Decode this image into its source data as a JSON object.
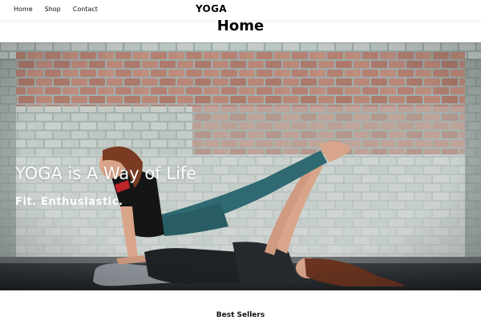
{
  "header": {
    "nav": [
      {
        "label": "Home"
      },
      {
        "label": "Shop"
      },
      {
        "label": "Contact"
      }
    ],
    "brand": "YOGA"
  },
  "page": {
    "title": "Home"
  },
  "hero": {
    "heading": "YOGA is A Way of Life",
    "subheading": "Fit. Enthusiastic.",
    "image_subject": "two-women-partner-yoga-brick-wall"
  },
  "sections": {
    "best_sellers": "Best Sellers"
  },
  "colors": {
    "wall": "#a8b4b0",
    "brick": "#b46a5a",
    "floor": "#2a2d33",
    "leggings": "#2f6a72",
    "top": "#1a1a1a"
  }
}
